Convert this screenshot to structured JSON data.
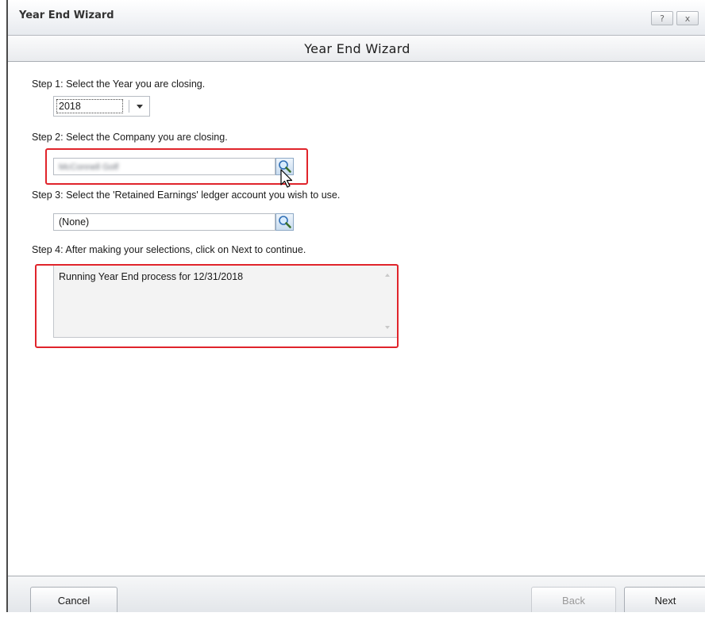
{
  "window": {
    "title": "Year End Wizard",
    "help_button": "?",
    "close_button": "x"
  },
  "header": {
    "title": "Year End Wizard"
  },
  "steps": {
    "step1": {
      "label": "Step 1:  Select the Year you are closing.",
      "year_value": "2018"
    },
    "step2": {
      "label": "Step 2:  Select the Company you are closing.",
      "company_value": "McConnell Golf"
    },
    "step3": {
      "label": "Step 3: Select the 'Retained Earnings' ledger account you wish to use.",
      "account_value": "(None)"
    },
    "step4": {
      "label": "Step 4:  After making your selections, click on Next to continue.",
      "log_text": "Running Year End process for 12/31/2018"
    }
  },
  "footer": {
    "cancel_label": "Cancel",
    "back_label": "Back",
    "next_label": "Next"
  },
  "icons": {
    "search": "magnifier-icon",
    "dropdown": "chevron-down-icon",
    "cursor": "mouse-pointer-icon"
  },
  "colors": {
    "highlight_box": "#e0242b",
    "header_band": "#e9ebee",
    "search_button": "#c9dcef"
  }
}
